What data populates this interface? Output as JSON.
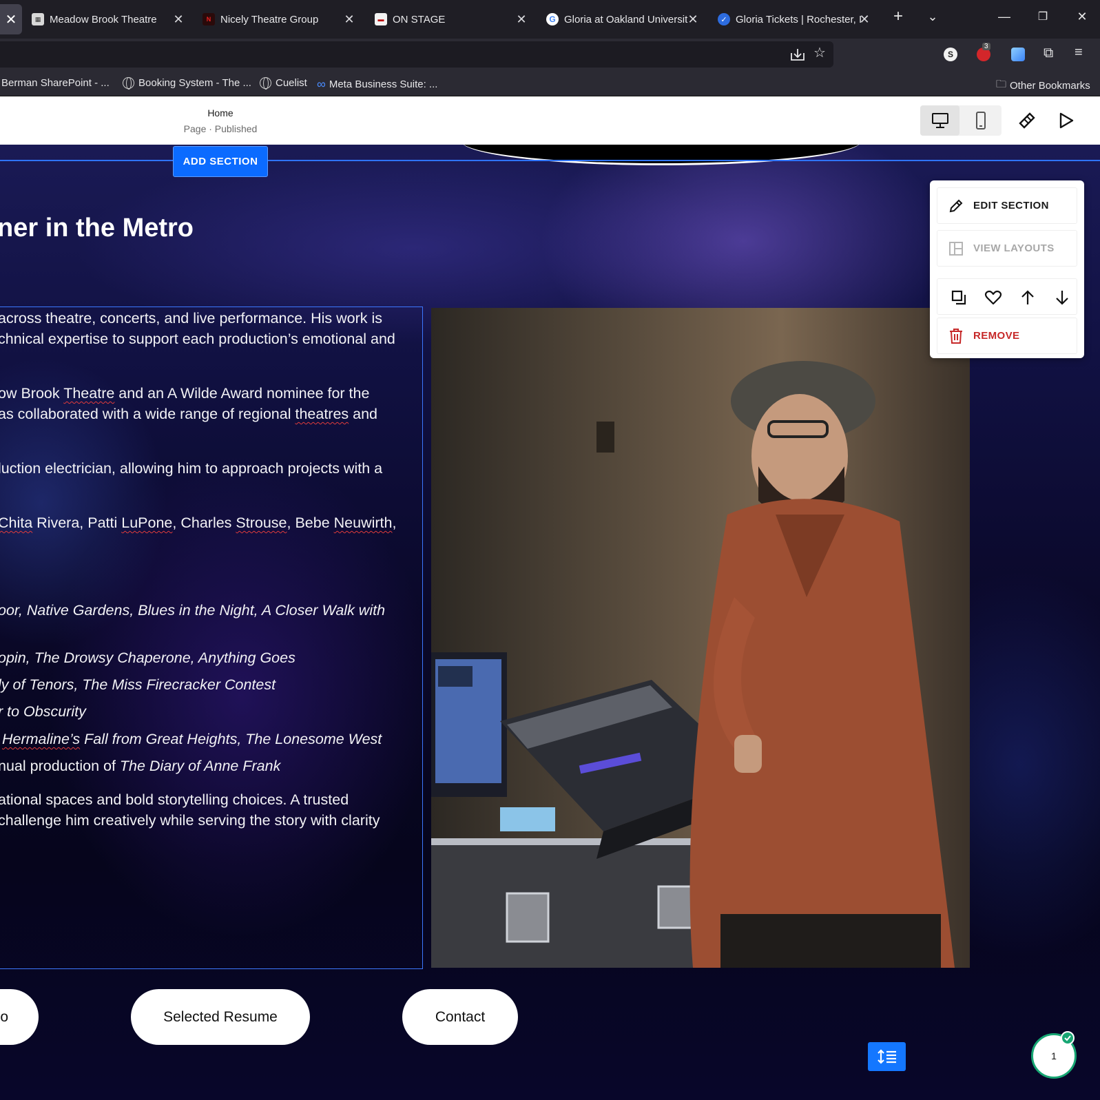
{
  "browser": {
    "tabs": [
      {
        "title": "Meadow Brook Theatre",
        "favicon": "theatre-icon"
      },
      {
        "title": "Nicely Theatre Group",
        "favicon": "nicely-icon"
      },
      {
        "title": "ON STAGE",
        "favicon": "onstage-icon"
      },
      {
        "title": "Gloria at Oakland Universit",
        "favicon": "google-icon"
      },
      {
        "title": "Gloria Tickets | Rochester, I",
        "favicon": "tickets-icon"
      }
    ],
    "extensions": {
      "abp_badge": "3",
      "s_badge": "S"
    },
    "bookmarks": [
      {
        "label": "Berman SharePoint - ..."
      },
      {
        "label": "Booking System - The ..."
      },
      {
        "label": "Cuelist"
      },
      {
        "label": "Meta Business Suite: ..."
      }
    ],
    "other_bookmarks": "Other Bookmarks"
  },
  "editor": {
    "page_name": "Home",
    "page_status": "Page · Published",
    "add_section": "ADD SECTION"
  },
  "section_panel": {
    "edit": "EDIT SECTION",
    "view_layouts": "VIEW LAYOUTS",
    "remove": "REMOVE"
  },
  "content": {
    "headline": "ner in the Metro",
    "lines": [
      {
        "pre": "across theatre, concerts, and live performance. His work is"
      },
      {
        "pre": "chnical expertise to support each production’s emotional and"
      },
      {
        "pre": "ow Brook ",
        "sq": "Theatre",
        "post": " and an A Wilde Award nominee for the"
      },
      {
        "pre": "as collaborated with a wide range of regional ",
        "sq": "theatres",
        "post": " and"
      },
      {
        "pre": "luction electrician, allowing him to approach projects with a"
      },
      {
        "pre": " ",
        "sq": "Chita",
        "post": " Rivera, Patti ",
        "sq2": "LuPone",
        "post2": ", Charles ",
        "sq3": "Strouse",
        "post3": ", Bebe ",
        "sq4": "Neuwirth",
        "post4": ","
      },
      {
        "italic": "oor, Native Gardens, Blues in the Night, A Closer Walk with"
      },
      {
        "italic": "opin, The Drowsy Chaperone, Anything Goes"
      },
      {
        "italic": "ly of Tenors, The Miss Firecracker Contest"
      },
      {
        "italic": "r to Obscurity"
      },
      {
        "italic_sq": "Hermaline’s",
        "italic": " Fall from Great Heights, The Lonesome West"
      },
      {
        "pre": "nual production of ",
        "italic": "The Diary of Anne Frank"
      },
      {
        "pre": "ational spaces and bold storytelling choices. A trusted"
      },
      {
        "pre": "challenge him creatively while serving the story with clarity"
      }
    ]
  },
  "nav_buttons": {
    "partial": "o",
    "resume": "Selected Resume",
    "contact": "Contact"
  },
  "counter": "1",
  "colors": {
    "accent": "#0b6bff",
    "danger": "#c62828",
    "chrome": "#1f1e25"
  }
}
